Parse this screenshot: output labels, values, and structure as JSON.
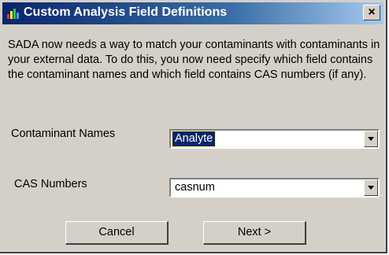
{
  "window": {
    "title": "Custom Analysis Field Definitions",
    "close_glyph": "×",
    "icon": "sada-app-icon"
  },
  "description": "SADA now needs a way to match your contaminants with contaminants in your external data.  To do this, you now need specify which field contains the contaminant names and which field contains CAS numbers (if any).",
  "fields": {
    "contaminant_names": {
      "label": "Contaminant Names",
      "value": "Analyte"
    },
    "cas_numbers": {
      "label": "CAS Numbers",
      "value": "casnum"
    }
  },
  "buttons": {
    "cancel": "Cancel",
    "next": "Next >"
  },
  "colors": {
    "titlebar_start": "#0a246a",
    "titlebar_end": "#a6caf0",
    "dialog_face": "#d4d0c8",
    "selection": "#0a246a"
  }
}
